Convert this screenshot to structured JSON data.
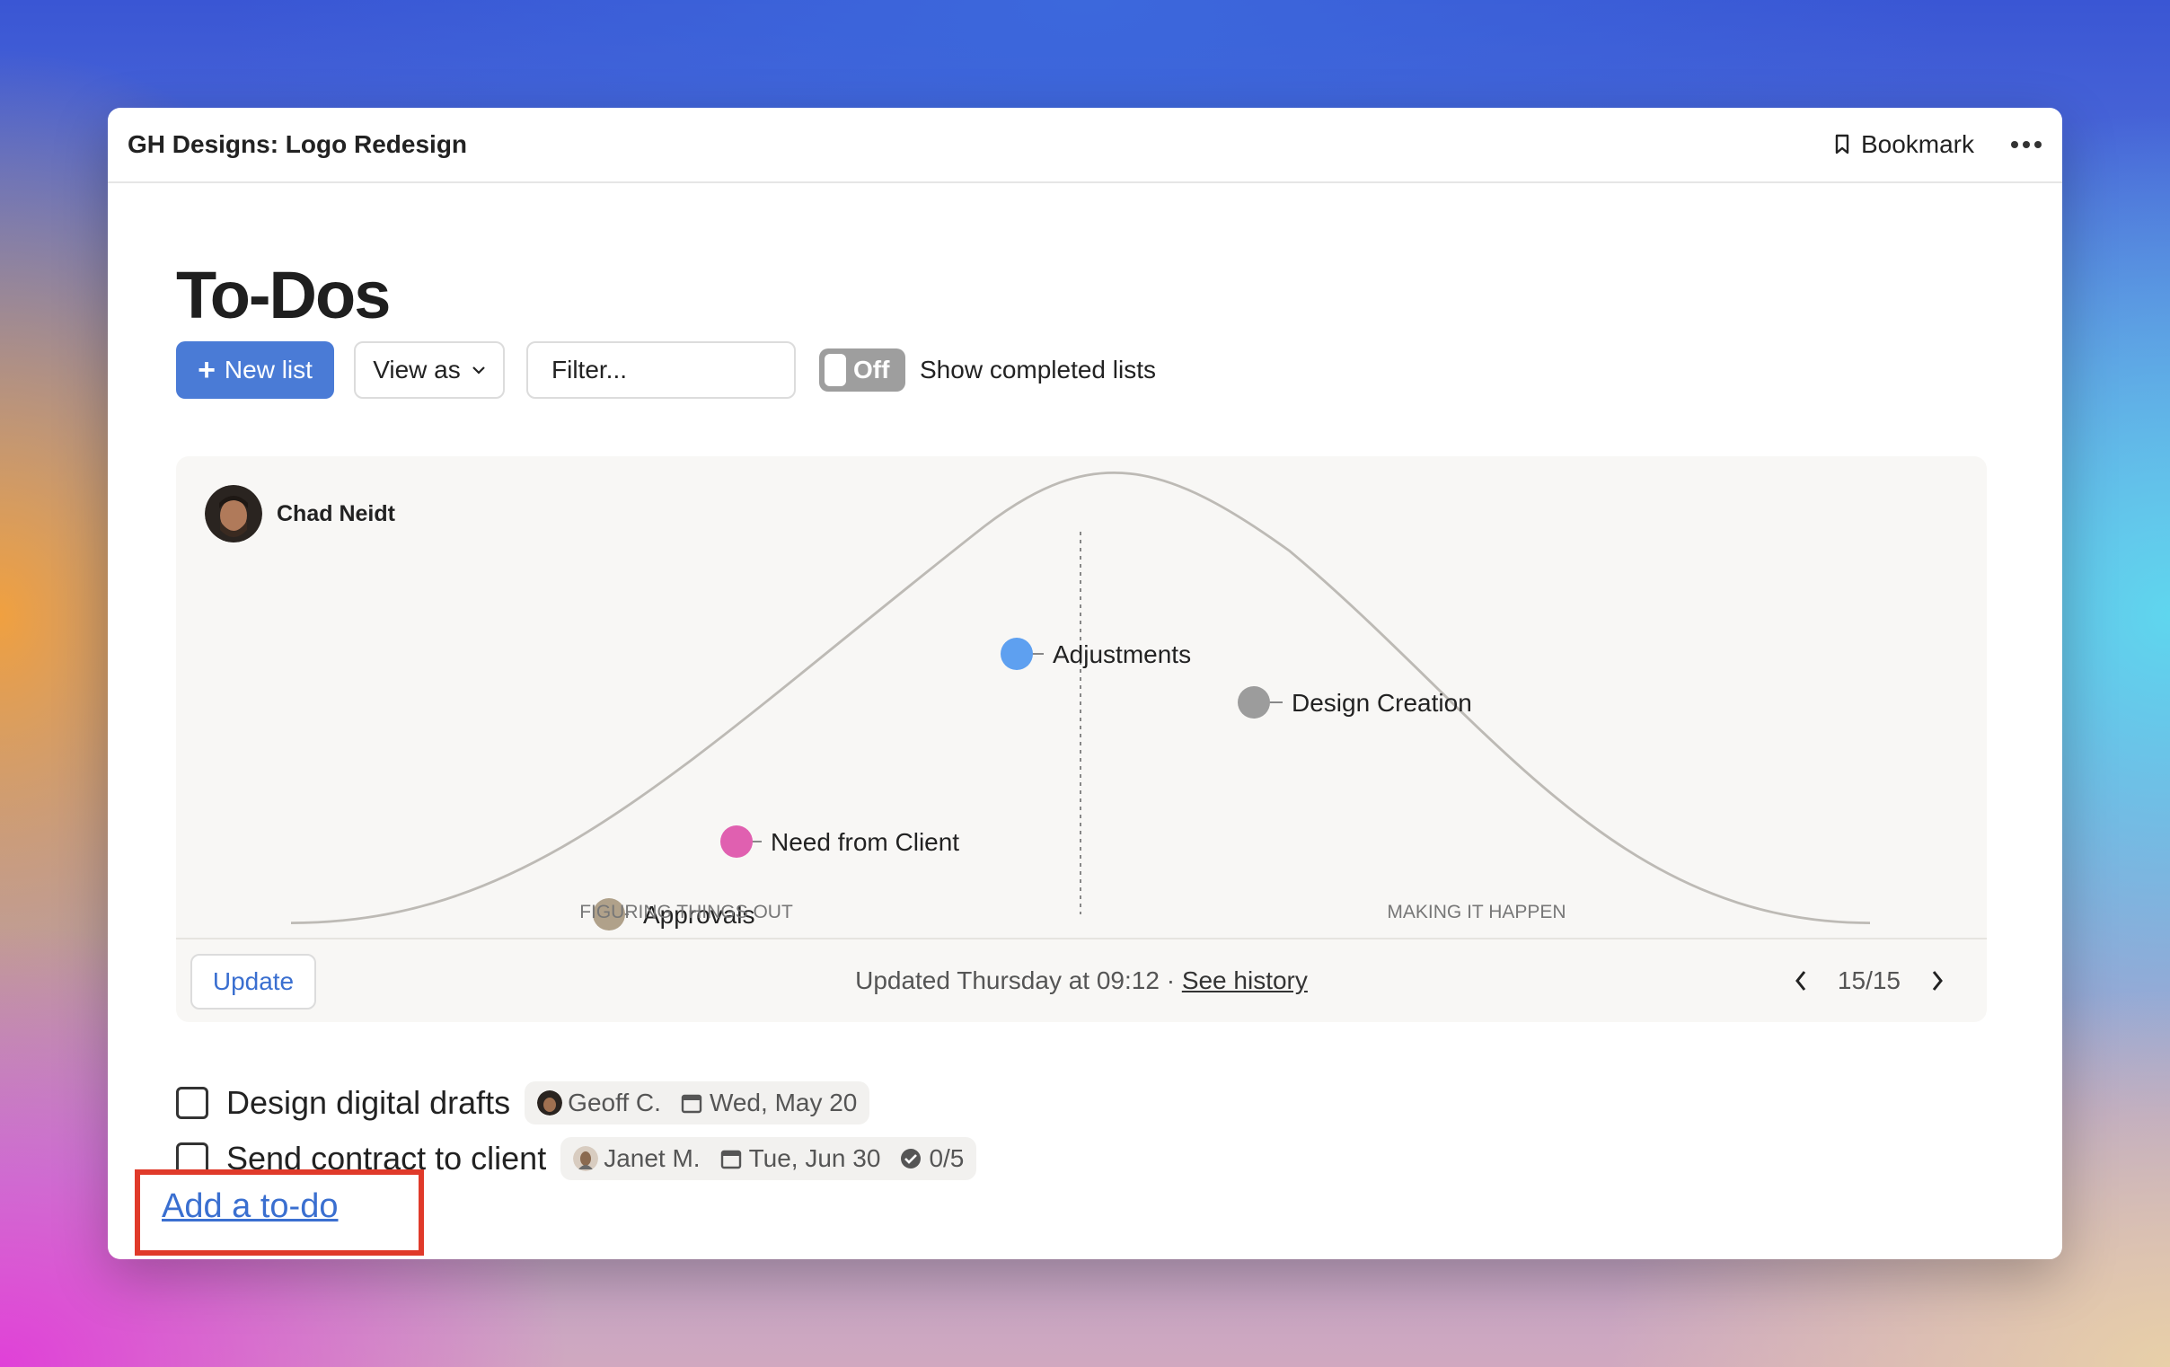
{
  "window": {
    "title": "GH Designs: Logo Redesign",
    "bookmark_label": "Bookmark",
    "more_icon": "ellipsis-icon"
  },
  "page": {
    "title": "To-Dos"
  },
  "toolbar": {
    "new_list_label": "New list",
    "view_as_label": "View as",
    "filter_placeholder": "Filter...",
    "toggle_state": "Off",
    "toggle_label": "Show completed lists"
  },
  "hill_chart": {
    "owner": "Chad Neidt",
    "phases": [
      "FIGURING THINGS OUT",
      "MAKING IT HAPPEN"
    ],
    "items": [
      {
        "label": "Approvals",
        "color": "#b0a18a"
      },
      {
        "label": "Need from Client",
        "color": "#e060b0"
      },
      {
        "label": "Adjustments",
        "color": "#5ea0f0"
      },
      {
        "label": "Design Creation",
        "color": "#9c9c9c"
      }
    ],
    "update_label": "Update",
    "updated_text": "Updated Thursday at 09:12 · ",
    "see_history_label": "See history",
    "pager": "15/15"
  },
  "todos": [
    {
      "text": "Design digital drafts",
      "assignee": "Geoff C.",
      "due": "Wed, May 20"
    },
    {
      "text": "Send contract to client",
      "assignee": "Janet M.",
      "due": "Tue, Jun 30",
      "progress": "0/5"
    }
  ],
  "add_todo_label": "Add a to-do",
  "colors": {
    "accent": "#4a7bd6",
    "link": "#3a6fd0",
    "highlight": "#e03a2a",
    "toggle_off": "#9e9e9e"
  }
}
